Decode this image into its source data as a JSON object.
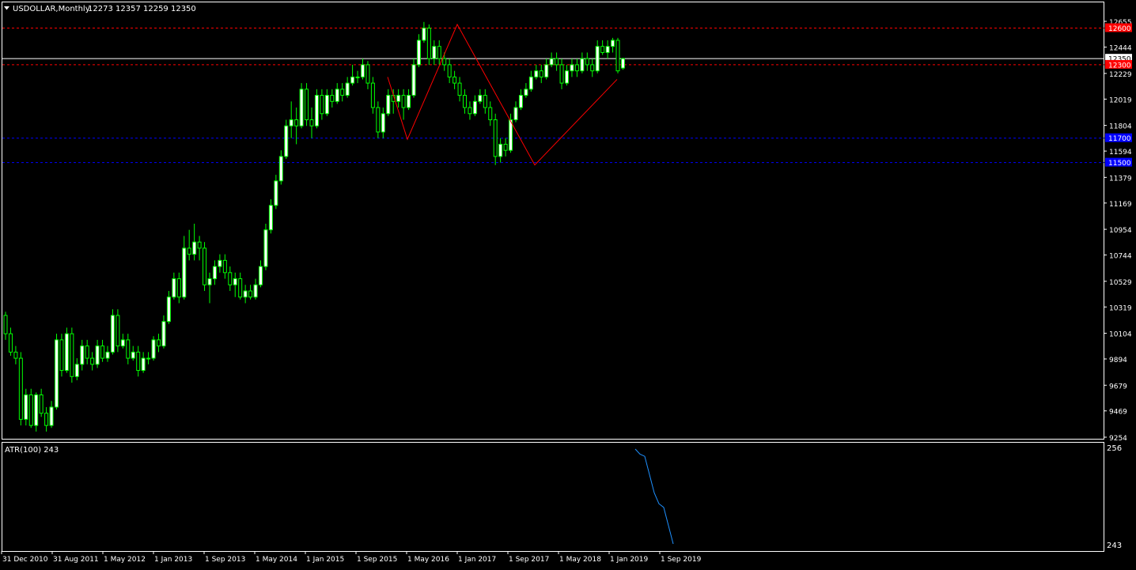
{
  "header": {
    "symbol": "USDOLLAR,Monthly",
    "ohlc": "12273 12357 12259 12350",
    "dropdown_icon": "triangle-down-icon"
  },
  "indicator": {
    "label": "ATR(100) 243",
    "scale_top": "256",
    "scale_bottom": "243"
  },
  "colors": {
    "background": "#000000",
    "bull_candle": "#ffffff",
    "candle_outline": "#00ff00",
    "bear_candle": "#000000",
    "zigzag": "#ff0000",
    "resistance": "#ff0000",
    "support": "#0000ff",
    "atr_line": "#1e90ff",
    "axis_text": "#ffffff",
    "frame": "#ffffff"
  },
  "chart_data": {
    "type": "candlestick",
    "title": "USDOLLAR,Monthly",
    "ylim": [
      9254,
      12655
    ],
    "y_ticks": [
      "12655",
      "12444",
      "12229",
      "12019",
      "11804",
      "11594",
      "11379",
      "11169",
      "10954",
      "10744",
      "10529",
      "10319",
      "10104",
      "9894",
      "9679",
      "9469",
      "9254"
    ],
    "x_ticks": [
      "31 Dec 2010",
      "31 Aug 2011",
      "1 May 2012",
      "1 Jan 2013",
      "1 Sep 2013",
      "1 May 2014",
      "1 Jan 2015",
      "1 Sep 2015",
      "1 May 2016",
      "1 Jan 2017",
      "1 Sep 2017",
      "1 May 2018",
      "1 Jan 2019",
      "1 Sep 2019"
    ],
    "horizontal_levels": [
      {
        "value": 12600,
        "label": "12600",
        "color": "#ff0000",
        "style": "dashed"
      },
      {
        "value": 12350,
        "label": "12350",
        "color": "#ffffff",
        "style": "solid"
      },
      {
        "value": 12300,
        "label": "12300",
        "color": "#ff0000",
        "style": "dashed"
      },
      {
        "value": 11700,
        "label": "11700",
        "color": "#0000ff",
        "style": "dashed"
      },
      {
        "value": 11500,
        "label": "11500",
        "color": "#0000ff",
        "style": "dashed"
      }
    ],
    "zigzag": [
      {
        "date": "Jan 2016",
        "value": 12200
      },
      {
        "date": "Mar 2016",
        "value": 11690
      },
      {
        "date": "Nov 2016",
        "value": 12630
      },
      {
        "date": "Jan 2018",
        "value": 11480
      },
      {
        "date": "Jan 2019",
        "value": 12180
      }
    ],
    "candles": [
      [
        10250,
        10100,
        10280,
        10050
      ],
      [
        10100,
        9950,
        10150,
        9920
      ],
      [
        9950,
        9900,
        10000,
        9850
      ],
      [
        9900,
        9400,
        9950,
        9350
      ],
      [
        9400,
        9600,
        9650,
        9350
      ],
      [
        9600,
        9350,
        9650,
        9330
      ],
      [
        9350,
        9600,
        9620,
        9300
      ],
      [
        9600,
        9450,
        9650,
        9420
      ],
      [
        9450,
        9350,
        9500,
        9300
      ],
      [
        9350,
        9500,
        9550,
        9330
      ],
      [
        9500,
        10050,
        10100,
        9480
      ],
      [
        10050,
        9800,
        10100,
        9750
      ],
      [
        9800,
        10100,
        10150,
        9780
      ],
      [
        10100,
        9750,
        10150,
        9700
      ],
      [
        9750,
        9850,
        9900,
        9720
      ],
      [
        9850,
        10000,
        10050,
        9800
      ],
      [
        10000,
        9900,
        10050,
        9850
      ],
      [
        9900,
        9850,
        9950,
        9800
      ],
      [
        9850,
        10000,
        10050,
        9820
      ],
      [
        10000,
        9900,
        10050,
        9870
      ],
      [
        9900,
        9950,
        10000,
        9870
      ],
      [
        9950,
        10250,
        10300,
        9930
      ],
      [
        10250,
        10000,
        10300,
        9950
      ],
      [
        10000,
        10050,
        10100,
        9980
      ],
      [
        10050,
        9900,
        10100,
        9850
      ],
      [
        9900,
        9950,
        10000,
        9880
      ],
      [
        9950,
        9800,
        10000,
        9750
      ],
      [
        9800,
        9900,
        9950,
        9780
      ],
      [
        9900,
        9900,
        9950,
        9850
      ],
      [
        9900,
        10050,
        10080,
        9880
      ],
      [
        10050,
        10000,
        10100,
        9950
      ],
      [
        10000,
        10200,
        10250,
        9980
      ],
      [
        10200,
        10400,
        10450,
        10180
      ],
      [
        10400,
        10550,
        10600,
        10380
      ],
      [
        10550,
        10400,
        10600,
        10350
      ],
      [
        10400,
        10800,
        10900,
        10380
      ],
      [
        10800,
        10750,
        10950,
        10700
      ],
      [
        10750,
        10850,
        11000,
        10700
      ],
      [
        10850,
        10800,
        10900,
        10700
      ],
      [
        10800,
        10500,
        10850,
        10450
      ],
      [
        10500,
        10550,
        10600,
        10350
      ],
      [
        10550,
        10650,
        10700,
        10500
      ],
      [
        10650,
        10700,
        10750,
        10600
      ],
      [
        10700,
        10600,
        10750,
        10550
      ],
      [
        10600,
        10500,
        10650,
        10450
      ],
      [
        10500,
        10550,
        10600,
        10400
      ],
      [
        10550,
        10400,
        10600,
        10380
      ],
      [
        10400,
        10450,
        10500,
        10350
      ],
      [
        10450,
        10400,
        10500,
        10380
      ],
      [
        10400,
        10500,
        10550,
        10380
      ],
      [
        10500,
        10650,
        10700,
        10480
      ],
      [
        10650,
        10950,
        11000,
        10620
      ],
      [
        10950,
        11150,
        11200,
        10920
      ],
      [
        11150,
        11350,
        11400,
        11120
      ],
      [
        11350,
        11550,
        11600,
        11320
      ],
      [
        11550,
        11800,
        11850,
        11530
      ],
      [
        11800,
        11850,
        12000,
        11700
      ],
      [
        11850,
        11800,
        11950,
        11650
      ],
      [
        11800,
        12100,
        12150,
        11780
      ],
      [
        12100,
        11850,
        12150,
        11800
      ],
      [
        11850,
        11800,
        11950,
        11700
      ],
      [
        11800,
        12050,
        12100,
        11780
      ],
      [
        12050,
        11900,
        12100,
        11850
      ],
      [
        11900,
        12050,
        12100,
        11880
      ],
      [
        12050,
        12000,
        12100,
        11950
      ],
      [
        12000,
        12100,
        12150,
        11980
      ],
      [
        12100,
        12050,
        12150,
        12000
      ],
      [
        12050,
        12150,
        12200,
        12030
      ],
      [
        12150,
        12200,
        12300,
        12130
      ],
      [
        12200,
        12200,
        12250,
        12150
      ],
      [
        12200,
        12300,
        12350,
        12180
      ],
      [
        12300,
        12150,
        12330,
        12100
      ],
      [
        12150,
        11950,
        12200,
        11900
      ],
      [
        11950,
        11750,
        12000,
        11700
      ],
      [
        11750,
        11900,
        11950,
        11700
      ],
      [
        11900,
        12050,
        12100,
        11880
      ],
      [
        12050,
        12000,
        12100,
        11900
      ],
      [
        12000,
        12050,
        12100,
        11950
      ],
      [
        12050,
        11950,
        12100,
        11850
      ],
      [
        11950,
        12050,
        12100,
        11930
      ],
      [
        12050,
        12300,
        12350,
        12030
      ],
      [
        12300,
        12500,
        12550,
        12280
      ],
      [
        12500,
        12600,
        12650,
        12480
      ],
      [
        12600,
        12350,
        12630,
        12300
      ],
      [
        12350,
        12450,
        12500,
        12300
      ],
      [
        12450,
        12350,
        12500,
        12300
      ],
      [
        12350,
        12300,
        12400,
        12250
      ],
      [
        12300,
        12200,
        12350,
        12150
      ],
      [
        12200,
        12150,
        12250,
        12100
      ],
      [
        12150,
        12050,
        12200,
        12000
      ],
      [
        12050,
        11950,
        12100,
        11900
      ],
      [
        11950,
        11900,
        12000,
        11850
      ],
      [
        11900,
        12000,
        12050,
        11880
      ],
      [
        12000,
        12050,
        12100,
        11980
      ],
      [
        12050,
        11950,
        12100,
        11900
      ],
      [
        11950,
        11850,
        12000,
        11800
      ],
      [
        11850,
        11550,
        11900,
        11480
      ],
      [
        11550,
        11650,
        11700,
        11500
      ],
      [
        11650,
        11600,
        11700,
        11550
      ],
      [
        11600,
        11850,
        11900,
        11580
      ],
      [
        11850,
        11950,
        12000,
        11830
      ],
      [
        11950,
        12050,
        12100,
        11930
      ],
      [
        12050,
        12100,
        12150,
        12030
      ],
      [
        12100,
        12200,
        12250,
        12080
      ],
      [
        12200,
        12250,
        12300,
        12180
      ],
      [
        12250,
        12200,
        12300,
        12150
      ],
      [
        12200,
        12300,
        12350,
        12180
      ],
      [
        12300,
        12350,
        12400,
        12280
      ],
      [
        12350,
        12300,
        12400,
        12250
      ],
      [
        12300,
        12150,
        12350,
        12100
      ],
      [
        12150,
        12250,
        12300,
        12130
      ],
      [
        12250,
        12300,
        12350,
        12200
      ],
      [
        12300,
        12250,
        12350,
        12200
      ],
      [
        12250,
        12350,
        12400,
        12230
      ],
      [
        12350,
        12300,
        12400,
        12250
      ],
      [
        12300,
        12250,
        12350,
        12200
      ],
      [
        12250,
        12450,
        12500,
        12230
      ],
      [
        12450,
        12400,
        12500,
        12380
      ],
      [
        12400,
        12450,
        12500,
        12350
      ],
      [
        12450,
        12500,
        12520,
        12400
      ],
      [
        12500,
        12250,
        12520,
        12230
      ],
      [
        12273,
        12350,
        12357,
        12259
      ]
    ],
    "atr": {
      "label": "ATR(100) 243",
      "ylim": [
        243,
        256
      ],
      "values": [
        256,
        255.3,
        255.0,
        252.5,
        250.0,
        248.5,
        248.0,
        245.5,
        243
      ]
    }
  }
}
